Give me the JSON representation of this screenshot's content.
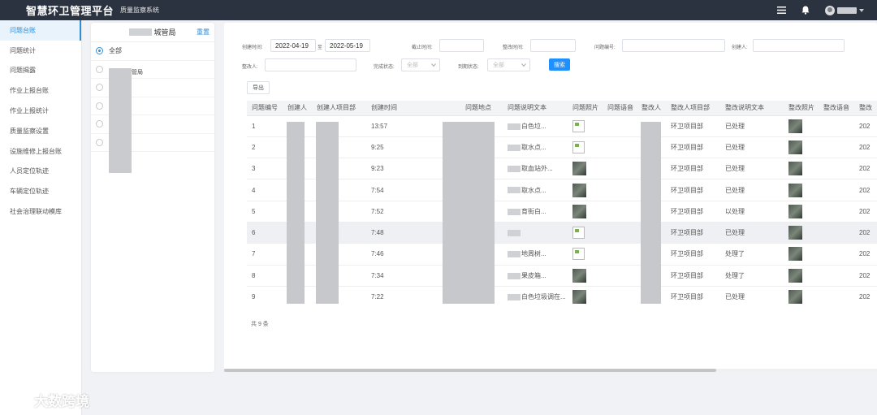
{
  "header": {
    "title": "智慧环卫管理平台",
    "subsystem": "质量监察系统"
  },
  "nav": {
    "items": [
      {
        "label": "问题台账",
        "active": true
      },
      {
        "label": "问题统计",
        "active": false
      },
      {
        "label": "问题揭露",
        "active": false
      },
      {
        "label": "作业上报台账",
        "active": false
      },
      {
        "label": "作业上报统计",
        "active": false
      },
      {
        "label": "质量监察设置",
        "active": false
      },
      {
        "label": "设施维修上报台账",
        "active": false
      },
      {
        "label": "人员定位轨迹",
        "active": false
      },
      {
        "label": "车辆定位轨迹",
        "active": false
      },
      {
        "label": "社会治理联动模库",
        "active": false
      }
    ]
  },
  "tree": {
    "title_suffix": "城管局",
    "reset": "重置",
    "all_label": "全部",
    "mgmt_label": "管局"
  },
  "filters": {
    "create_time_label": "创建时间:",
    "start_date": "2022-04-19",
    "range_sep": "至",
    "end_date": "2022-05-19",
    "deadline_label": "截止时间:",
    "rectify_time_label": "整改时间:",
    "issue_no_label": "问题编号:",
    "creator_label": "创建人:",
    "rectifier_label": "整改人:",
    "completion_label": "完成状态:",
    "completion_value": "全部",
    "due_label": "到期状态:",
    "due_value": "全部",
    "search": "搜索",
    "export": "导出"
  },
  "table": {
    "columns": [
      "问题编号",
      "创建人",
      "创建人项目部",
      "创建时间",
      "问题地点",
      "问题说明文本",
      "问题照片",
      "问题语音",
      "整改人",
      "整改人项目部",
      "整改说明文本",
      "整改照片",
      "整改语音",
      "整改"
    ],
    "rows": [
      {
        "no": "1",
        "dept": "项目部",
        "time": "13:57",
        "loc": "区(",
        "desc": "白色垃...",
        "photo": "broken",
        "rdept": "环卫项目部",
        "rdesc": "已处理",
        "rtail": "202"
      },
      {
        "no": "2",
        "dept": "项目部",
        "time": "9:25",
        "loc": "区(",
        "desc": "取水点...",
        "photo": "broken",
        "rdept": "环卫项目部",
        "rdesc": "已处理",
        "rtail": "202"
      },
      {
        "no": "3",
        "dept": "项目部",
        "time": "9:23",
        "loc": "区(",
        "desc": "取血站外...",
        "photo": "thumb",
        "rdept": "环卫项目部",
        "rdesc": "已处理",
        "rtail": "202"
      },
      {
        "no": "4",
        "dept": "项目部",
        "time": "7:54",
        "loc": "区(",
        "desc": "取水点...",
        "photo": "thumb",
        "rdept": "环卫项目部",
        "rdesc": "已处理",
        "rtail": "202"
      },
      {
        "no": "5",
        "dept": "项目部",
        "time": "7:52",
        "loc": "区",
        "desc": "育街白...",
        "photo": "thumb",
        "rdept": "环卫项目部",
        "rdesc": "以处理",
        "rtail": "202"
      },
      {
        "no": "6",
        "dept": "项目部",
        "time": "7:48",
        "loc": "区",
        "desc": "",
        "photo": "broken",
        "rdept": "环卫项目部",
        "rdesc": "已处理",
        "rtail": "202"
      },
      {
        "no": "7",
        "dept": "项目部",
        "time": "7:46",
        "loc": "",
        "desc": "地周树...",
        "photo": "broken",
        "rdept": "环卫项目部",
        "rdesc": "处理了",
        "rtail": "202"
      },
      {
        "no": "8",
        "dept": "项目部",
        "time": "7:34",
        "loc": "区(",
        "desc": "果皮箱...",
        "photo": "thumb",
        "rdept": "环卫项目部",
        "rdesc": "处理了",
        "rtail": "202"
      },
      {
        "no": "9",
        "dept": "项目部",
        "time": "7:22",
        "loc": "区",
        "desc": "白色垃圾调在...",
        "photo": "thumb",
        "rdept": "环卫项目部",
        "rdesc": "已处理",
        "rtail": "202"
      }
    ],
    "highlight_row": 5,
    "total": "共 9 条"
  },
  "watermark": {
    "footer": "大数跨境"
  }
}
